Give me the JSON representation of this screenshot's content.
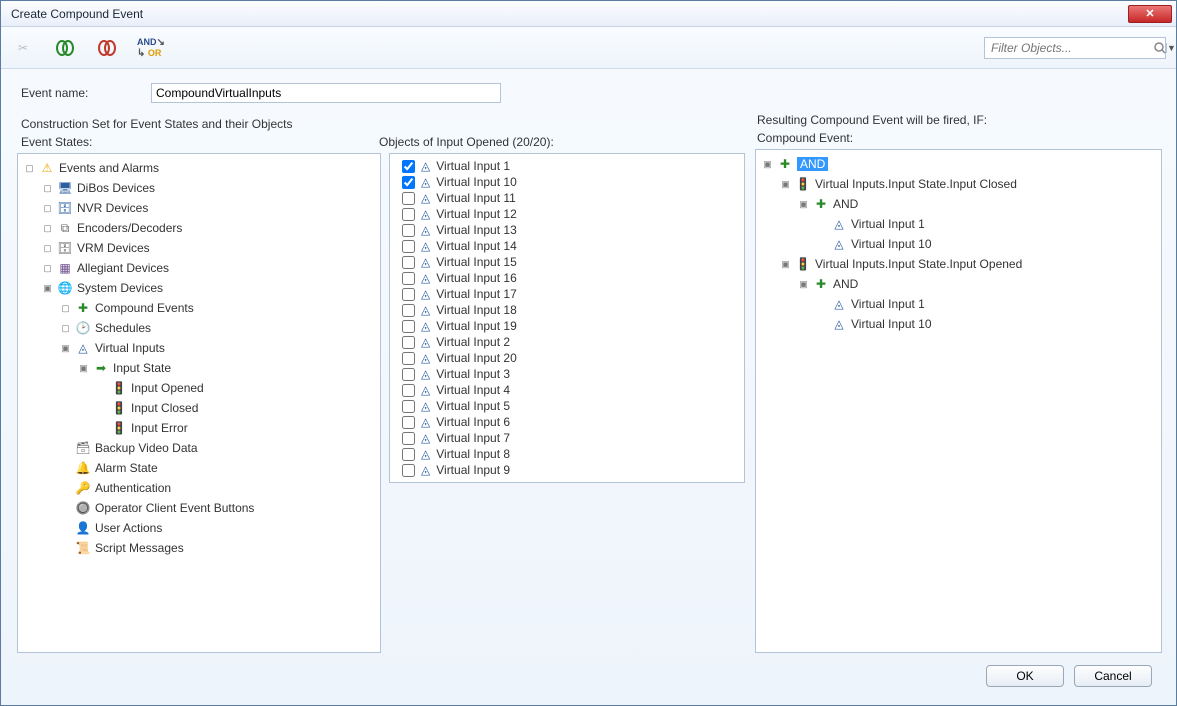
{
  "window": {
    "title": "Create Compound Event"
  },
  "toolbar": {
    "filter_placeholder": "Filter Objects..."
  },
  "form": {
    "event_name_label": "Event name:",
    "event_name_value": "CompoundVirtualInputs"
  },
  "captions": {
    "construction_set": "Construction Set for Event States and their Objects",
    "event_states": "Event States:",
    "objects_of": "Objects of Input Opened (20/20):",
    "resulting": "Resulting Compound Event will be fired, IF:",
    "compound_event": "Compound Event:"
  },
  "event_tree": {
    "root": "Events and Alarms",
    "dibos": "DiBos Devices",
    "nvr": "NVR Devices",
    "encdec": "Encoders/Decoders",
    "vrm": "VRM Devices",
    "allegiant": "Allegiant Devices",
    "sysdev": "System Devices",
    "compound_events": "Compound Events",
    "schedules": "Schedules",
    "virtual_inputs": "Virtual Inputs",
    "input_state": "Input State",
    "input_opened": "Input Opened",
    "input_closed": "Input Closed",
    "input_error": "Input Error",
    "backup_video": "Backup Video Data",
    "alarm_state": "Alarm State",
    "authentication": "Authentication",
    "op_client_buttons": "Operator Client Event Buttons",
    "user_actions": "User Actions",
    "script_messages": "Script Messages"
  },
  "objects": [
    {
      "label": "Virtual Input 1",
      "checked": true
    },
    {
      "label": "Virtual Input 10",
      "checked": true
    },
    {
      "label": "Virtual Input 11",
      "checked": false
    },
    {
      "label": "Virtual Input 12",
      "checked": false
    },
    {
      "label": "Virtual Input 13",
      "checked": false
    },
    {
      "label": "Virtual Input 14",
      "checked": false
    },
    {
      "label": "Virtual Input 15",
      "checked": false
    },
    {
      "label": "Virtual Input 16",
      "checked": false
    },
    {
      "label": "Virtual Input 17",
      "checked": false
    },
    {
      "label": "Virtual Input 18",
      "checked": false
    },
    {
      "label": "Virtual Input 19",
      "checked": false
    },
    {
      "label": "Virtual Input 2",
      "checked": false
    },
    {
      "label": "Virtual Input 20",
      "checked": false
    },
    {
      "label": "Virtual Input 3",
      "checked": false
    },
    {
      "label": "Virtual Input 4",
      "checked": false
    },
    {
      "label": "Virtual Input 5",
      "checked": false
    },
    {
      "label": "Virtual Input 6",
      "checked": false
    },
    {
      "label": "Virtual Input 7",
      "checked": false
    },
    {
      "label": "Virtual Input 8",
      "checked": false
    },
    {
      "label": "Virtual Input 9",
      "checked": false
    }
  ],
  "result_tree": {
    "root_and": "AND",
    "closed_path": "Virtual Inputs.Input State.Input Closed",
    "closed_and": "AND",
    "closed_c1": "Virtual Input 1",
    "closed_c2": "Virtual Input 10",
    "opened_path": "Virtual Inputs.Input State.Input Opened",
    "opened_and": "AND",
    "opened_c1": "Virtual Input 1",
    "opened_c2": "Virtual Input 10"
  },
  "buttons": {
    "ok": "OK",
    "cancel": "Cancel"
  }
}
